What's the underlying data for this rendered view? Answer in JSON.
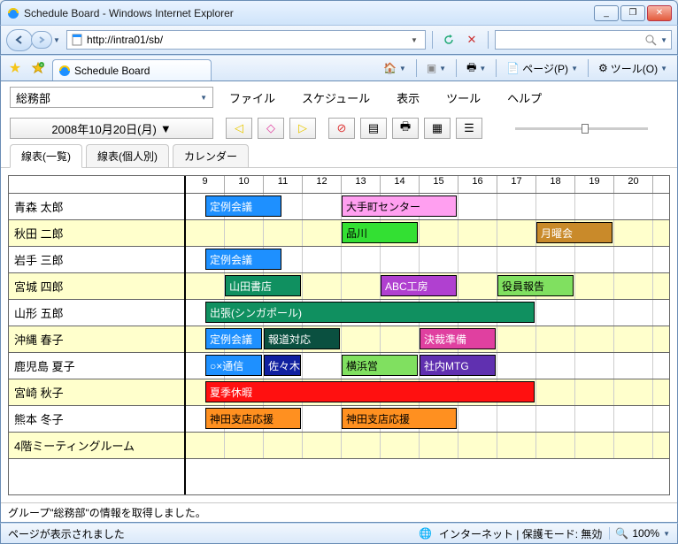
{
  "window": {
    "title": "Schedule Board - Windows Internet Explorer",
    "min": "_",
    "max": "❐",
    "close": "✕"
  },
  "nav": {
    "back": "◄",
    "fwd": "►",
    "url": "http://intra01/sb/",
    "refresh": "↻",
    "stop": "✕",
    "search_placeholder": ""
  },
  "tabbar": {
    "tab_title": "Schedule Board",
    "home": "🏠",
    "rss": "▦",
    "print": "🖶",
    "page_label": "ページ(P)",
    "tools_label": "ツール(O)"
  },
  "app": {
    "group_selected": "総務部",
    "menu": {
      "file": "ファイル",
      "schedule": "スケジュール",
      "view": "表示",
      "tools": "ツール",
      "help": "ヘルプ"
    },
    "date": "2008年10月20日(月)",
    "nav_btns": {
      "prev": "◁",
      "today": "◇",
      "next": "▷",
      "special1": "⊘",
      "special2": "▤",
      "print": "🖶",
      "grid": "▦",
      "list": "☰"
    },
    "tabs": {
      "list": "線表(一覧)",
      "individual": "線表(個人別)",
      "calendar": "カレンダー"
    },
    "hours": [
      "9",
      "10",
      "11",
      "12",
      "13",
      "14",
      "15",
      "16",
      "17",
      "18",
      "19",
      "20"
    ],
    "people": [
      {
        "name": "青森 太郎",
        "shade": false
      },
      {
        "name": "秋田 二郎",
        "shade": true
      },
      {
        "name": "岩手 三郎",
        "shade": false
      },
      {
        "name": "宮城 四郎",
        "shade": true
      },
      {
        "name": "山形 五郎",
        "shade": false
      },
      {
        "name": "沖縄 春子",
        "shade": true
      },
      {
        "name": "鹿児島 夏子",
        "shade": false
      },
      {
        "name": "宮崎 秋子",
        "shade": true
      },
      {
        "name": "熊本 冬子",
        "shade": false
      },
      {
        "name": "4階ミーティングルーム",
        "shade": true
      }
    ],
    "events": [
      {
        "row": 0,
        "start": 9.5,
        "end": 11.5,
        "label": "定例会議",
        "bg": "#1e90ff",
        "fg": "#fff"
      },
      {
        "row": 0,
        "start": 13,
        "end": 16,
        "label": "大手町センター",
        "bg": "#ff9ff0",
        "fg": "#000"
      },
      {
        "row": 1,
        "start": 13,
        "end": 15,
        "label": "品川",
        "bg": "#33e033",
        "fg": "#000"
      },
      {
        "row": 1,
        "start": 18,
        "end": 20,
        "label": "月曜会",
        "bg": "#c98a2a",
        "fg": "#fff"
      },
      {
        "row": 2,
        "start": 9.5,
        "end": 11.5,
        "label": "定例会議",
        "bg": "#1e90ff",
        "fg": "#fff"
      },
      {
        "row": 3,
        "start": 10,
        "end": 12,
        "label": "山田書店",
        "bg": "#109060",
        "fg": "#fff"
      },
      {
        "row": 3,
        "start": 14,
        "end": 16,
        "label": "ABC工房",
        "bg": "#b040d0",
        "fg": "#fff"
      },
      {
        "row": 3,
        "start": 17,
        "end": 19,
        "label": "役員報告",
        "bg": "#80e060",
        "fg": "#000"
      },
      {
        "row": 4,
        "start": 9.5,
        "end": 18,
        "label": "出張(シンガポール)",
        "bg": "#109060",
        "fg": "#fff"
      },
      {
        "row": 5,
        "start": 9.5,
        "end": 11,
        "label": "定例会議",
        "bg": "#1e90ff",
        "fg": "#fff"
      },
      {
        "row": 5,
        "start": 11,
        "end": 13,
        "label": "報道対応",
        "bg": "#0a5040",
        "fg": "#fff"
      },
      {
        "row": 5,
        "start": 15,
        "end": 17,
        "label": "決裁準備",
        "bg": "#e040a0",
        "fg": "#fff"
      },
      {
        "row": 6,
        "start": 9.5,
        "end": 11,
        "label": "○×通信",
        "bg": "#1e90ff",
        "fg": "#fff"
      },
      {
        "row": 6,
        "start": 11,
        "end": 12,
        "label": "佐々木",
        "bg": "#1020a0",
        "fg": "#fff"
      },
      {
        "row": 6,
        "start": 13,
        "end": 15,
        "label": "横浜営",
        "bg": "#80e060",
        "fg": "#000"
      },
      {
        "row": 6,
        "start": 15,
        "end": 17,
        "label": "社内MTG",
        "bg": "#6030b0",
        "fg": "#fff"
      },
      {
        "row": 7,
        "start": 9.5,
        "end": 18,
        "label": "夏季休暇",
        "bg": "#ff1010",
        "fg": "#fff"
      },
      {
        "row": 8,
        "start": 9.5,
        "end": 12,
        "label": "神田支店応援",
        "bg": "#ff9020",
        "fg": "#000"
      },
      {
        "row": 8,
        "start": 13,
        "end": 16,
        "label": "神田支店応援",
        "bg": "#ff9020",
        "fg": "#000"
      }
    ],
    "status": "グループ\"総務部\"の情報を取得しました。"
  },
  "bstatus": {
    "page": "ページが表示されました",
    "zone": "インターネット | 保護モード: 無効",
    "zoom": "100%"
  },
  "colors": {
    "accent": "#1e90ff"
  }
}
